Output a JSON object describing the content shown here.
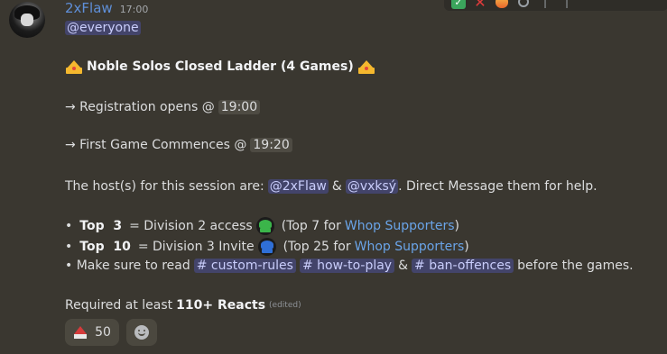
{
  "message": {
    "username": "2xFlaw",
    "timestamp": "17:00",
    "mention_everyone": "@everyone",
    "title": "Noble Solos Closed Ladder (4 Games)",
    "registration_label": "→ Registration opens @",
    "registration_time": "19:00",
    "first_game_label": "→ First Game Commences @",
    "first_game_time": "19:20",
    "hosts_prefix": "The host(s) for this session are:",
    "host1": "@2xFlaw",
    "hosts_and": "&",
    "host2": "@vxksý",
    "hosts_suffix": ". Direct Message them for help.",
    "top3_bullet": "•",
    "top3_label": "Top  3",
    "top3_text": "= Division 2 access",
    "top3_after_open": "(Top 7 for",
    "supporters_link": "Whop Supporters",
    "close_paren": ")",
    "top10_bullet": "•",
    "top10_label": "Top  10",
    "top10_text": "= Division 3 Invite",
    "top10_after_open": "(Top 25 for",
    "read_prefix": "• Make sure to read",
    "channel1": "# custom-rules",
    "channel2": "# how-to-play",
    "read_and": "&",
    "channel3": "# ban-offences",
    "read_suffix": "before the games.",
    "required_prefix": "Required at least",
    "required_bold": "110+ Reacts",
    "edited": "(edited)"
  },
  "reaction": {
    "count": "50"
  }
}
